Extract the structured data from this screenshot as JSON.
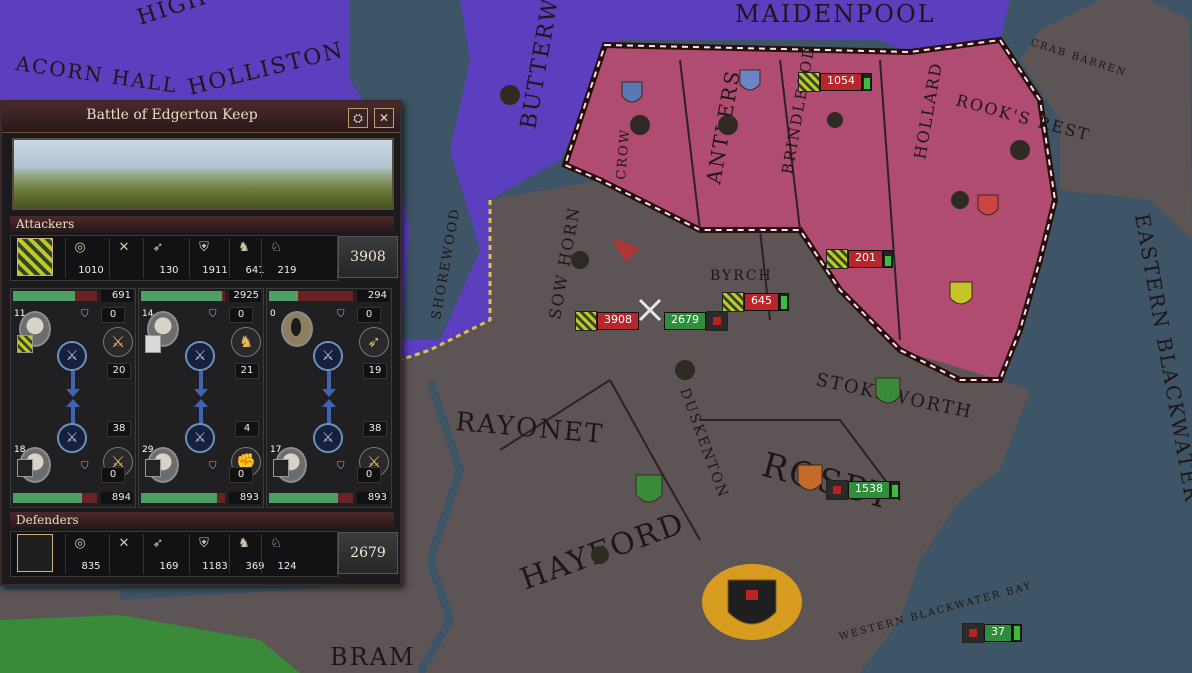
{
  "map": {
    "labels": [
      "HIGH",
      "ACORN HALL",
      "HOLLISTON",
      "BUTTERWELL",
      "MAIDENPOOL",
      "CRAB BARREN",
      "ROOK'S REST",
      "ANTLERS",
      "BRINDLEOOD",
      "HOLLARD",
      "SOW HORN",
      "BYRCH",
      "SHOREWOOD",
      "RAYONET",
      "DUSKENTON",
      "STOKEWORTH",
      "ROSBY",
      "HAYFORD",
      "EASTERN BLACKWATER",
      "WESTERN BLACKWATER BAY",
      "BRAM",
      "CROW"
    ],
    "units": [
      {
        "value": "1054",
        "color": "red"
      },
      {
        "value": "201",
        "color": "red"
      },
      {
        "value": "645",
        "color": "red"
      },
      {
        "value": "3908",
        "color": "red"
      },
      {
        "value": "2679",
        "color": "green"
      },
      {
        "value": "1538",
        "color": "green"
      },
      {
        "value": "37",
        "color": "green"
      }
    ],
    "colors": {
      "purple": "#5b3fbf",
      "pink": "#b04b71",
      "land": "#5d5456",
      "sea": "#3d5566",
      "green": "#3a8a3a"
    }
  },
  "panel": {
    "title": "Battle of Edgerton Keep",
    "buttons": {
      "pin": "⛭",
      "close": "✕"
    },
    "attackers": {
      "label": "Attackers",
      "stats": [
        "1010",
        "",
        "130",
        "1911",
        "641",
        "219"
      ],
      "total": "3908"
    },
    "defenders": {
      "label": "Defenders",
      "stats": [
        "835",
        "",
        "169",
        "1183",
        "369",
        "124"
      ],
      "total": "2679"
    },
    "stat_icons": [
      "bow-icon",
      "crossed-swords-icon",
      "archer-icon",
      "heavy-infantry-icon",
      "light-cavalry-icon",
      "knight-icon"
    ],
    "flanks": [
      {
        "attacker_strength": "691",
        "attacker_fill": 0.74,
        "level": "11",
        "a_helm": "0",
        "a_tactic": "20",
        "d_tactic": "38",
        "d_level": "18",
        "d_helm": "0",
        "defender_strength": "894",
        "defender_fill": 0.82
      },
      {
        "attacker_strength": "2925",
        "attacker_fill": 0.96,
        "level": "14",
        "a_helm": "0",
        "a_tactic": "21",
        "d_tactic": "4",
        "d_level": "29",
        "d_helm": "0",
        "defender_strength": "893",
        "defender_fill": 0.91
      },
      {
        "attacker_strength": "294",
        "attacker_fill": 0.35,
        "level": "0",
        "a_helm": "0",
        "a_tactic": "19",
        "d_tactic": "38",
        "d_level": "17",
        "d_helm": "0",
        "defender_strength": "893",
        "defender_fill": 0.82
      }
    ]
  }
}
